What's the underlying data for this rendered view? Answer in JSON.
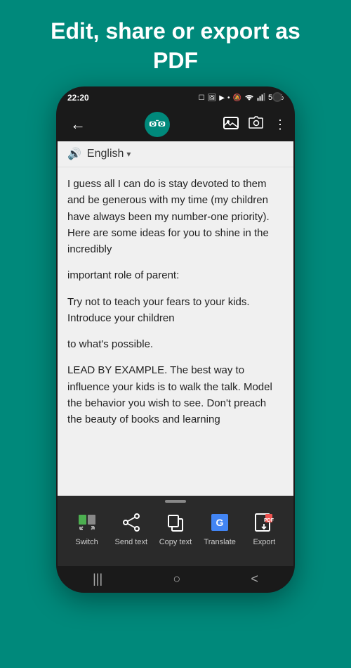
{
  "page": {
    "header": "Edit, share or export as PDF",
    "background_color": "#00897B"
  },
  "status_bar": {
    "time": "22:20",
    "battery": "55%",
    "icons": [
      "☐",
      "🖼",
      "📷",
      "•",
      "🔕",
      "📶",
      "📶"
    ]
  },
  "toolbar": {
    "back_label": "←",
    "more_label": "⋮"
  },
  "language_bar": {
    "language": "English",
    "speaker_icon": "🔊",
    "dropdown_icon": "▾"
  },
  "text_content": [
    "I guess all I can do is stay devoted to them and be generous with my time (my children have always been my number-one priority). Here are some ideas for you to shine in the incredibly",
    "important role of parent:",
    "Try not to teach your fears to your kids. Introduce your children",
    "to what's possible.",
    "LEAD BY EXAMPLE. The best way to influence your kids is to walk the talk. Model the behavior you wish to see. Don't preach the beauty of books and learning"
  ],
  "bottom_actions": [
    {
      "id": "switch",
      "label": "Switch",
      "icon": "switch"
    },
    {
      "id": "send-text",
      "label": "Send text",
      "icon": "share"
    },
    {
      "id": "copy-text",
      "label": "Copy text",
      "icon": "copy"
    },
    {
      "id": "translate",
      "label": "Translate",
      "icon": "translate"
    },
    {
      "id": "export",
      "label": "Export",
      "icon": "pdf"
    }
  ],
  "nav_bar": {
    "menu_icon": "|||",
    "home_icon": "○",
    "back_icon": "<"
  }
}
